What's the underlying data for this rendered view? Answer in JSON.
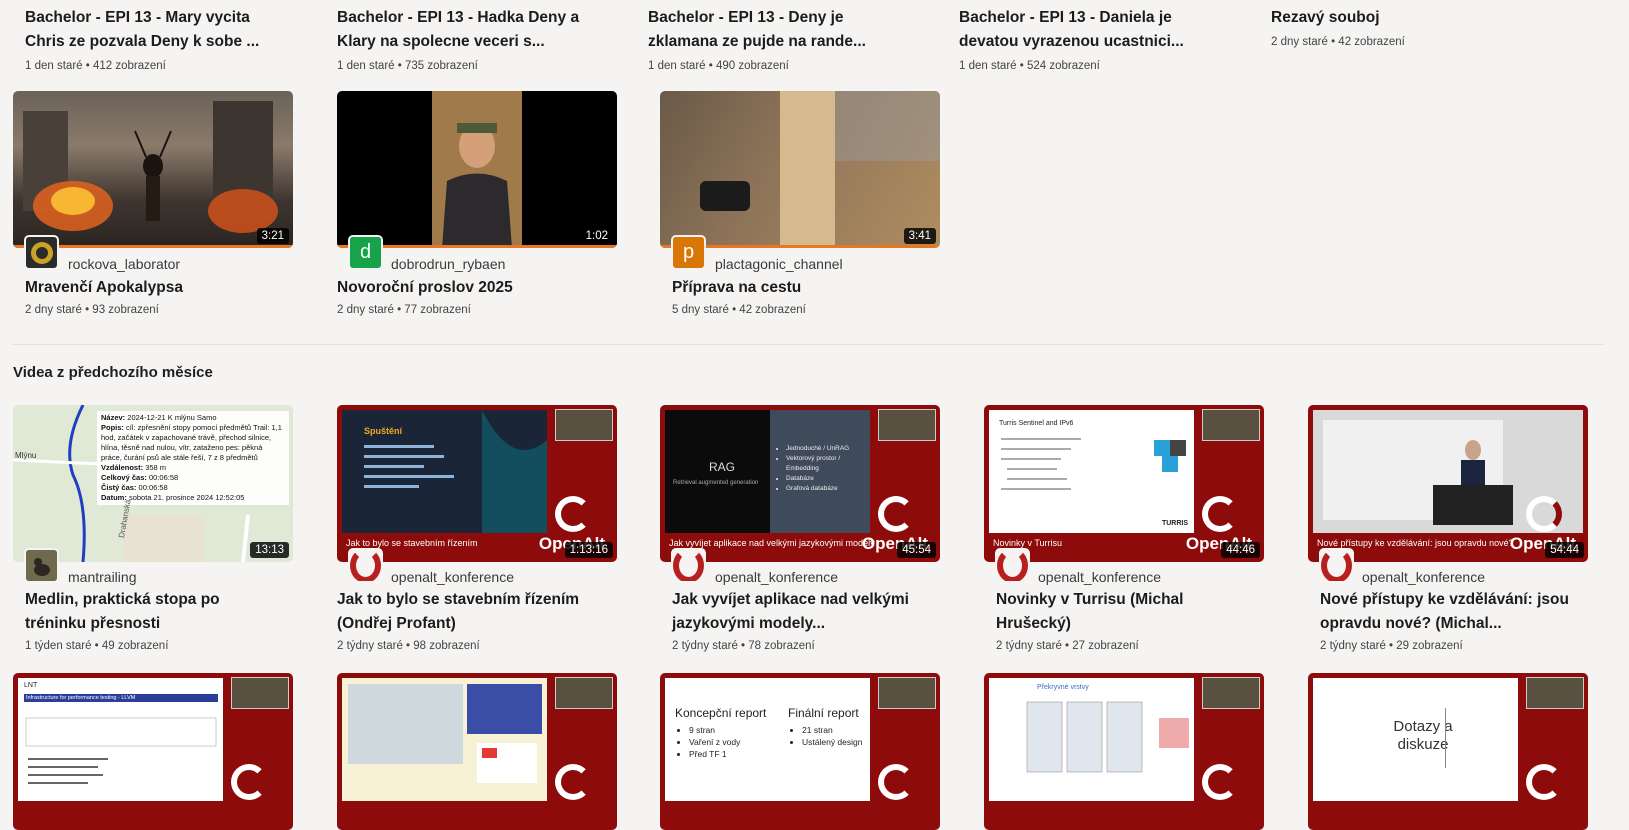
{
  "row1": [
    {
      "title": "Bachelor - EPI 13 - Mary vycita Chris ze pozvala Deny k sobe ...",
      "meta": "1 den staré • 412 zobrazení"
    },
    {
      "title": "Bachelor - EPI 13 - Hadka Deny a Klary na spolecne veceri s...",
      "meta": "1 den staré • 735 zobrazení"
    },
    {
      "title": "Bachelor - EPI 13 - Deny je zklamana ze pujde na rande...",
      "meta": "1 den staré • 490 zobrazení"
    },
    {
      "title": "Bachelor - EPI 13 - Daniela je devatou vyrazenou ucastnici...",
      "meta": "1 den staré • 524 zobrazení"
    },
    {
      "title": "Rezavý souboj",
      "meta": "2 dny staré • 42 zobrazení"
    }
  ],
  "row2": [
    {
      "channel": "rockova_laborator",
      "avatar_letter": "",
      "avatar_color": "#2b2b2b",
      "title": "Mravenčí Apokalypsa",
      "meta": "2 dny staré • 93 zobrazení",
      "duration": "3:21"
    },
    {
      "channel": "dobrodrun_rybaen",
      "avatar_letter": "d",
      "avatar_color": "#16a34a",
      "title": "Novoroční proslov 2025",
      "meta": "2 dny staré • 77 zobrazení",
      "duration": "1:02"
    },
    {
      "channel": "plactagonic_channel",
      "avatar_letter": "p",
      "avatar_color": "#d97706",
      "title": "Příprava na cestu",
      "meta": "5 dny staré • 42 zobrazení",
      "duration": "3:41"
    }
  ],
  "section": {
    "title": "Videa z předchozího měsíce"
  },
  "row3": [
    {
      "channel": "mantrailing",
      "title": "Medlin, praktická stopa po tréninku přesnosti",
      "meta": "1 týden staré • 49 zobrazení",
      "duration": "13:13",
      "map": {
        "nazev_label": "Název:",
        "nazev": "2024-12-21 K mlýnu Samo",
        "popis_label": "Popis:",
        "popis": "cíl: zpřesnění stopy pomocí předmětů Trail: 1,1 hod, začátek v zapachované trávě, přechod silnice, hlína, těsně nad nulou, vítr, zataženo pes: pěkná práce, čurání psů ale stále řeší, 7 z 8 předmětů",
        "vzd_label": "Vzdálenost:",
        "vzd": "358 m",
        "celk_label": "Celkový čas:",
        "celk": "00:06:58",
        "cist_label": "Čistý čas:",
        "cist": "00:06:58",
        "datum_label": "Datum:",
        "datum": "sobota 21. prosince 2024 12:52:05",
        "place": "Mlýnu",
        "street": "Drahanská"
      }
    },
    {
      "channel": "openalt_konference",
      "title": "Jak to bylo se stavebním řízením (Ondřej Profant)",
      "meta": "2 týdny staré • 98 zobrazení",
      "duration": "1:13:16",
      "caption": "Jak to bylo se stavebním řízením",
      "slide_heading": "Spuštění"
    },
    {
      "channel": "openalt_konference",
      "title": "Jak vyvíjet aplikace nad velkými jazykovými modely...",
      "meta": "2 týdny staré • 78 zobrazení",
      "duration": "45:54",
      "caption": "Jak vyvíjet aplikace nad velkými jazykovými modely",
      "slide_heading": "RAG",
      "slide_sub": "Retrieval augmented generation",
      "slide_items": [
        "Jednoduché / UnRAG",
        "Vektorový prostor / Embedding",
        "Databáze",
        "Grafová databáze"
      ]
    },
    {
      "channel": "openalt_konference",
      "title": "Novinky v Turrisu (Michal Hrušecký)",
      "meta": "2 týdny staré • 27 zobrazení",
      "duration": "44:46",
      "caption": "Novinky v Turrisu",
      "slide_heading": "Turris Sentinel and IPv6",
      "slide_logo": "TURRIS"
    },
    {
      "channel": "openalt_konference",
      "title": "Nové přístupy ke vzdělávání: jsou opravdu nové? (Michal...",
      "meta": "2 týdny staré • 29 zobrazení",
      "duration": "54:44",
      "caption": "Nové přístupy ke vzdělávání: jsou opravdu nové?"
    }
  ],
  "row4": [
    {
      "slide_heading": "LNT",
      "slide_sub": "Infrastructure for performance testing - LLVM"
    },
    {
      "slide_heading": ""
    },
    {
      "slide_col1": "Koncepční report",
      "slide_col1_items": [
        "9 stran",
        "Vaření z vody",
        "Před TF 1"
      ],
      "slide_col2": "Finální report",
      "slide_col2_items": [
        "21 stran",
        "Ustálený design"
      ]
    },
    {
      "slide_heading": "Překryvné vrstvy"
    },
    {
      "slide_heading": "Dotazy a diskuze"
    }
  ],
  "brand": {
    "name": "OpenAlt",
    "tag": "ko"
  }
}
